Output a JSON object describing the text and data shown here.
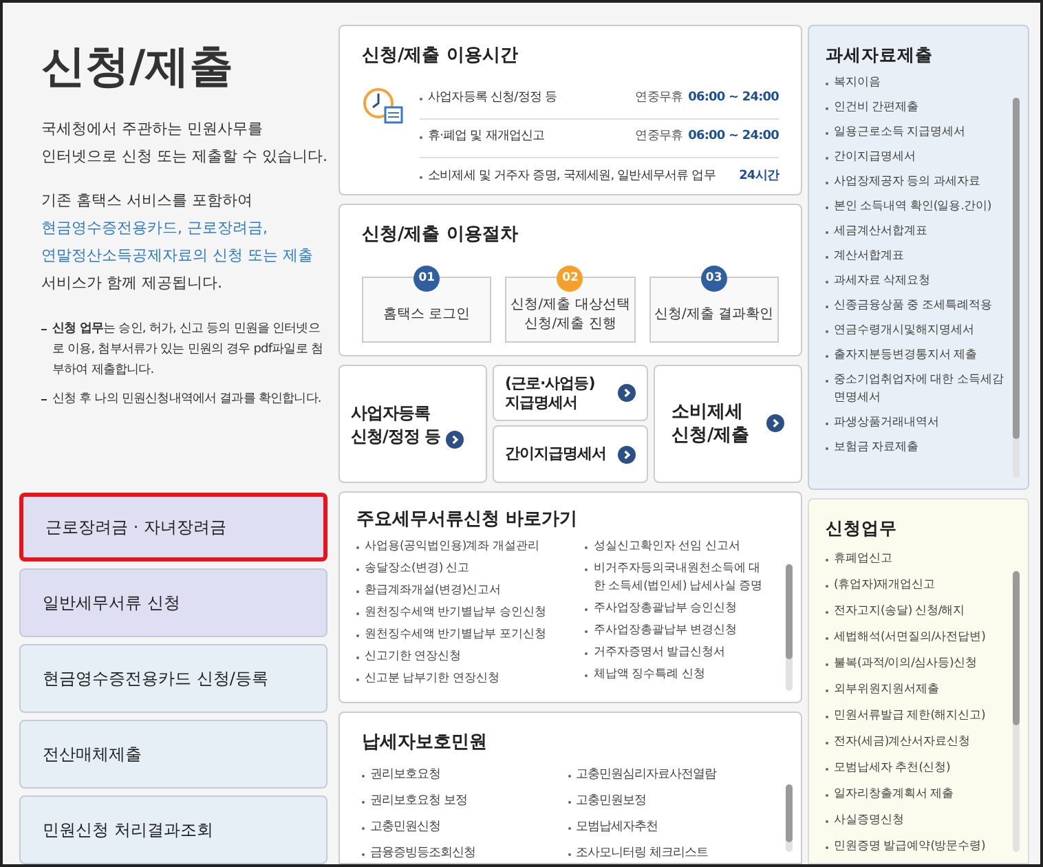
{
  "intro": {
    "title": "신청/제출",
    "lines": [
      "국세청에서 주관하는 민원사무를",
      "인터넷으로 신청 또는 제출할 수 있습니다."
    ],
    "services_lead": "기존 홈택스 서비스를 포함하여",
    "services_links": [
      "현금영수증전용카드, 근로장려금,",
      "연말정산소득공제자료의 신청 또는 제출"
    ],
    "services_tail": "서비스가 함께 제공됩니다.",
    "notes": [
      "**신청 업무**는 승인, 허가, 신고 등의 민원을 인터넷으로 이용, 첨부서류가 있는 민원의 경우 pdf파일로 첨부하여 제출합니다.",
      "신청 후 나의 민원신청내역에서 결과를 확인합니다."
    ]
  },
  "menu": [
    {
      "label": "근로장려금 · 자녀장려금",
      "selected": true,
      "color": "#dfdff3"
    },
    {
      "label": "일반세무서류 신청",
      "selected": false,
      "color": "#dfdff3"
    },
    {
      "label": "현금영수증전용카드 신청/등록",
      "selected": false,
      "color": "#e6eef6"
    },
    {
      "label": "전산매체제출",
      "selected": false,
      "color": "#e6eef6"
    },
    {
      "label": "민원신청 처리결과조회",
      "selected": false,
      "color": "#e6eef6"
    }
  ],
  "hours": {
    "title": "신청/제출 이용시간",
    "rows": [
      {
        "label": "사업자등록 신청/정정 등",
        "days": "연중무휴",
        "time": "06:00 ~ 24:00"
      },
      {
        "label": "휴·폐업 및 재개업신고",
        "days": "연중무휴",
        "time": "06:00 ~ 24:00"
      },
      {
        "label": "소비제세 및 거주자 증명, 국제세원, 일반세무서류 업무",
        "time": "24시간"
      }
    ]
  },
  "procedure": {
    "title": "신청/제출 이용절차",
    "steps": [
      {
        "number": "01",
        "lines": [
          "홈택스 로그인"
        ],
        "color": "#2f5f9e"
      },
      {
        "number": "02",
        "lines": [
          "신청/제출 대상선택",
          "신청/제출 진행"
        ],
        "color": "#f5a02a"
      },
      {
        "number": "03",
        "lines": [
          "신청/제출 결과확인"
        ],
        "color": "#2f5f9e"
      }
    ]
  },
  "shortcuts": {
    "left": [
      "사업자등록",
      "신청/정정 등"
    ],
    "middle": [
      [
        "(근로·사업등)",
        "지급명세서"
      ],
      [
        "간이지급명세서"
      ]
    ],
    "right": [
      "소비제세",
      "신청/제출"
    ]
  },
  "documents": {
    "title": "주요세무서류신청 바로가기",
    "columns": [
      [
        "사업용(공익법인용)계좌 개설관리",
        "송달장소(변경) 신고",
        "환급계좌개설(변경)신고서",
        "원천징수세액 반기별납부 승인신청",
        "원천징수세액 반기별납부 포기신청",
        "신고기한 연장신청",
        "신고분 납부기한 연장신청"
      ],
      [
        "성실신고확인자 선임 신고서",
        "비거주자등의국내원천소득에 대한 소득세(법인세) 납세사실 증명",
        "주사업장총괄납부 승인신청",
        "주사업장총괄납부 변경신청",
        "거주자증명서 발급신청서",
        "체납액 징수특례 신청"
      ]
    ]
  },
  "protection": {
    "title": "납세자보호민원",
    "columns": [
      [
        "권리보호요청",
        "권리보호요청 보정",
        "고충민원신청",
        "금융증빙등조회신청"
      ],
      [
        "고충민원심리자료사전열람",
        "고충민원보정",
        "모범납세자추천",
        "조사모니터링 체크리스트"
      ]
    ]
  },
  "taxdata": {
    "title": "과세자료제출",
    "items": [
      "복지이음",
      "인건비 간편제출",
      "일용근로소득 지급명세서",
      "간이지급명세서",
      "사업장제공자 등의 과세자료",
      "본인 소득내역 확인(일용.간이)",
      "세금계산서합계표",
      "계산서합계표",
      "과세자료 삭제요청",
      "신종금융상품 중 조세특례적용",
      "연금수령개시및해지명세서",
      "출자지분등변경통지서 제출",
      "중소기업취업자에 대한 소득세감면명세서",
      "파생상품거래내역서",
      "보험금 자료제출"
    ]
  },
  "applications": {
    "title": "신청업무",
    "items": [
      "휴폐업신고",
      "(휴업자)재개업신고",
      "전자고지(송달) 신청/해지",
      "세법해석(서면질의/사전답변)",
      "불복(과적/이의/심사등)신청",
      "외부위원지원서제출",
      "민원서류발급 제한(해지신고)",
      "전자(세금)계산서자료신청",
      "모범납세자 추천(신청)",
      "일자리창출계획서 제출",
      "사실증명신청",
      "민원증명 발급예약(방문수령)"
    ]
  }
}
